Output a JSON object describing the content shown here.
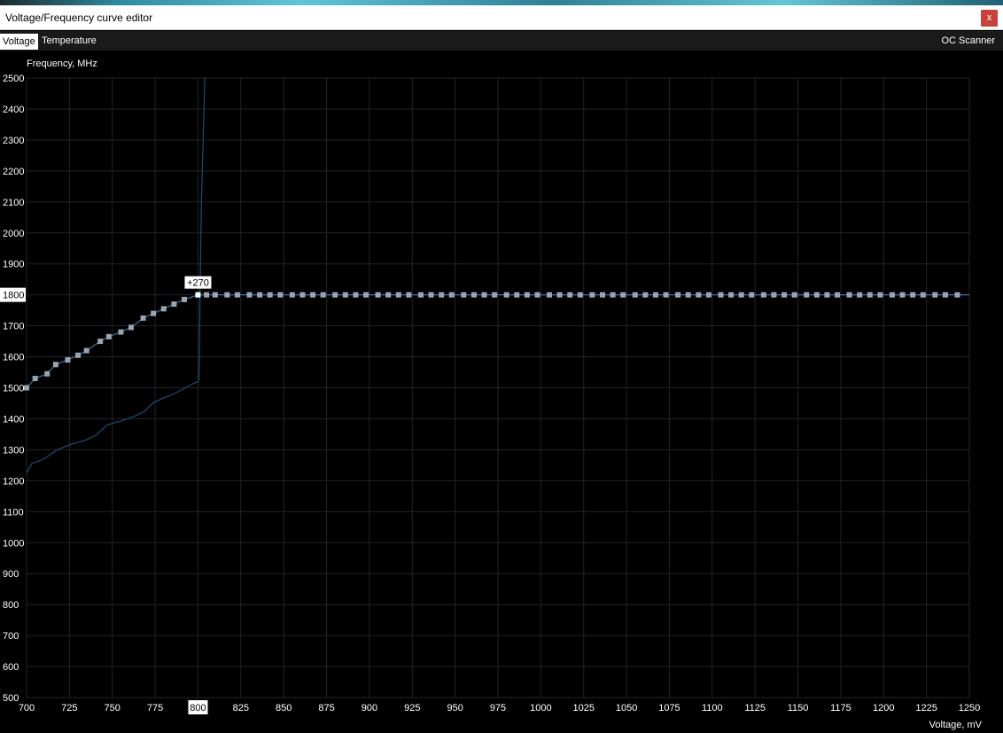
{
  "window": {
    "title": "Voltage/Frequency curve editor",
    "close_label": "x"
  },
  "tabs": {
    "voltage": "Voltage",
    "temperature": "Temperature",
    "oc_scanner": "OC Scanner"
  },
  "chart_data": {
    "type": "line",
    "ylabel": "Frequency, MHz",
    "xlabel": "Voltage, mV",
    "xlim": [
      700,
      1250
    ],
    "ylim": [
      500,
      2500
    ],
    "x_ticks": [
      700,
      725,
      750,
      775,
      800,
      825,
      850,
      875,
      900,
      925,
      950,
      975,
      1000,
      1025,
      1050,
      1075,
      1100,
      1125,
      1150,
      1175,
      1200,
      1225,
      1250
    ],
    "y_ticks": [
      500,
      600,
      700,
      800,
      900,
      1000,
      1100,
      1200,
      1300,
      1400,
      1500,
      1600,
      1700,
      1800,
      1900,
      2000,
      2100,
      2200,
      2300,
      2400,
      2500
    ],
    "highlighted_x_tick": 800,
    "highlighted_y_tick": 1800,
    "grid": true,
    "series": [
      {
        "points": [
          [
            700,
            1500
          ],
          [
            705,
            1530
          ],
          [
            712,
            1545
          ],
          [
            717,
            1575
          ],
          [
            724,
            1590
          ],
          [
            730,
            1605
          ],
          [
            735,
            1620
          ],
          [
            743,
            1650
          ],
          [
            748,
            1665
          ],
          [
            755,
            1680
          ],
          [
            761,
            1695
          ],
          [
            768,
            1725
          ],
          [
            774,
            1740
          ],
          [
            780,
            1755
          ],
          [
            786,
            1770
          ],
          [
            792,
            1785
          ],
          [
            800,
            1800
          ],
          [
            805,
            1800
          ],
          [
            810,
            1800
          ],
          [
            817,
            1800
          ],
          [
            823,
            1800
          ],
          [
            830,
            1800
          ],
          [
            836,
            1800
          ],
          [
            842,
            1800
          ],
          [
            848,
            1800
          ],
          [
            855,
            1800
          ],
          [
            861,
            1800
          ],
          [
            867,
            1800
          ],
          [
            873,
            1800
          ],
          [
            880,
            1800
          ],
          [
            886,
            1800
          ],
          [
            892,
            1800
          ],
          [
            898,
            1800
          ],
          [
            905,
            1800
          ],
          [
            911,
            1800
          ],
          [
            917,
            1800
          ],
          [
            923,
            1800
          ],
          [
            930,
            1800
          ],
          [
            936,
            1800
          ],
          [
            942,
            1800
          ],
          [
            948,
            1800
          ],
          [
            955,
            1800
          ],
          [
            961,
            1800
          ],
          [
            967,
            1800
          ],
          [
            973,
            1800
          ],
          [
            980,
            1800
          ],
          [
            986,
            1800
          ],
          [
            992,
            1800
          ],
          [
            998,
            1800
          ],
          [
            1005,
            1800
          ],
          [
            1011,
            1800
          ],
          [
            1017,
            1800
          ],
          [
            1023,
            1800
          ],
          [
            1030,
            1800
          ],
          [
            1036,
            1800
          ],
          [
            1042,
            1800
          ],
          [
            1048,
            1800
          ],
          [
            1055,
            1800
          ],
          [
            1061,
            1800
          ],
          [
            1067,
            1800
          ],
          [
            1073,
            1800
          ],
          [
            1080,
            1800
          ],
          [
            1086,
            1800
          ],
          [
            1092,
            1800
          ],
          [
            1098,
            1800
          ],
          [
            1105,
            1800
          ],
          [
            1111,
            1800
          ],
          [
            1117,
            1800
          ],
          [
            1123,
            1800
          ],
          [
            1130,
            1800
          ],
          [
            1136,
            1800
          ],
          [
            1142,
            1800
          ],
          [
            1148,
            1800
          ],
          [
            1155,
            1800
          ],
          [
            1161,
            1800
          ],
          [
            1167,
            1800
          ],
          [
            1173,
            1800
          ],
          [
            1180,
            1800
          ],
          [
            1186,
            1800
          ],
          [
            1192,
            1800
          ],
          [
            1198,
            1800
          ],
          [
            1205,
            1800
          ],
          [
            1211,
            1800
          ],
          [
            1217,
            1800
          ],
          [
            1223,
            1800
          ],
          [
            1230,
            1800
          ],
          [
            1236,
            1800
          ],
          [
            1243,
            1800
          ]
        ],
        "line_to": [
          1250,
          1800
        ],
        "color": "#9aa5b1",
        "line_color": "#3f6fa8",
        "selected_point": [
          800,
          1800
        ],
        "selected_label": "+270"
      },
      {
        "points": [
          [
            700,
            1225
          ],
          [
            703,
            1255
          ],
          [
            710,
            1270
          ],
          [
            718,
            1300
          ],
          [
            726,
            1318
          ],
          [
            734,
            1330
          ],
          [
            740,
            1345
          ],
          [
            747,
            1380
          ],
          [
            755,
            1393
          ],
          [
            763,
            1408
          ],
          [
            769,
            1425
          ],
          [
            774,
            1452
          ],
          [
            779,
            1465
          ],
          [
            785,
            1478
          ],
          [
            791,
            1495
          ],
          [
            796,
            1510
          ],
          [
            800,
            1520
          ],
          [
            800.5,
            1525
          ],
          [
            800.8,
            1580
          ],
          [
            801.2,
            1800
          ],
          [
            802,
            2100
          ],
          [
            803,
            2300
          ],
          [
            804,
            2500
          ]
        ],
        "line_color": "#1f4a78"
      }
    ]
  }
}
